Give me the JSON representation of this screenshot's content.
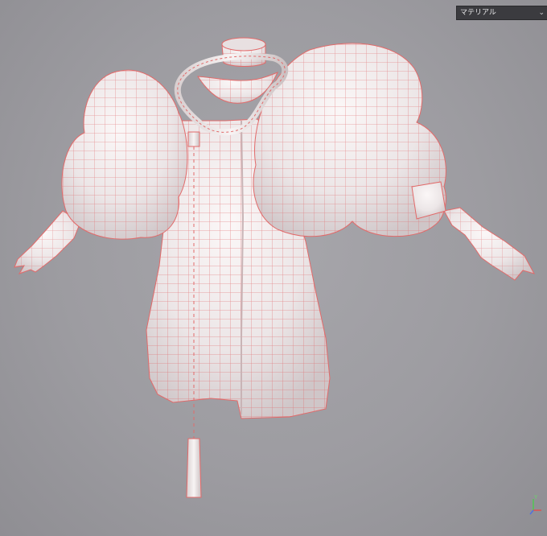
{
  "viewport": {
    "background_color": "#9d9ca1",
    "wireframe_color": "#e26a6a",
    "mesh_color": "#eeeaea"
  },
  "material_dropdown": {
    "selected_value": "マテリアル",
    "icon": "chevron-down-icon"
  },
  "axis_gizmo": {
    "y_label": "Y",
    "x_color": "#e05050",
    "y_color": "#50c850",
    "z_color": "#5070e0"
  }
}
